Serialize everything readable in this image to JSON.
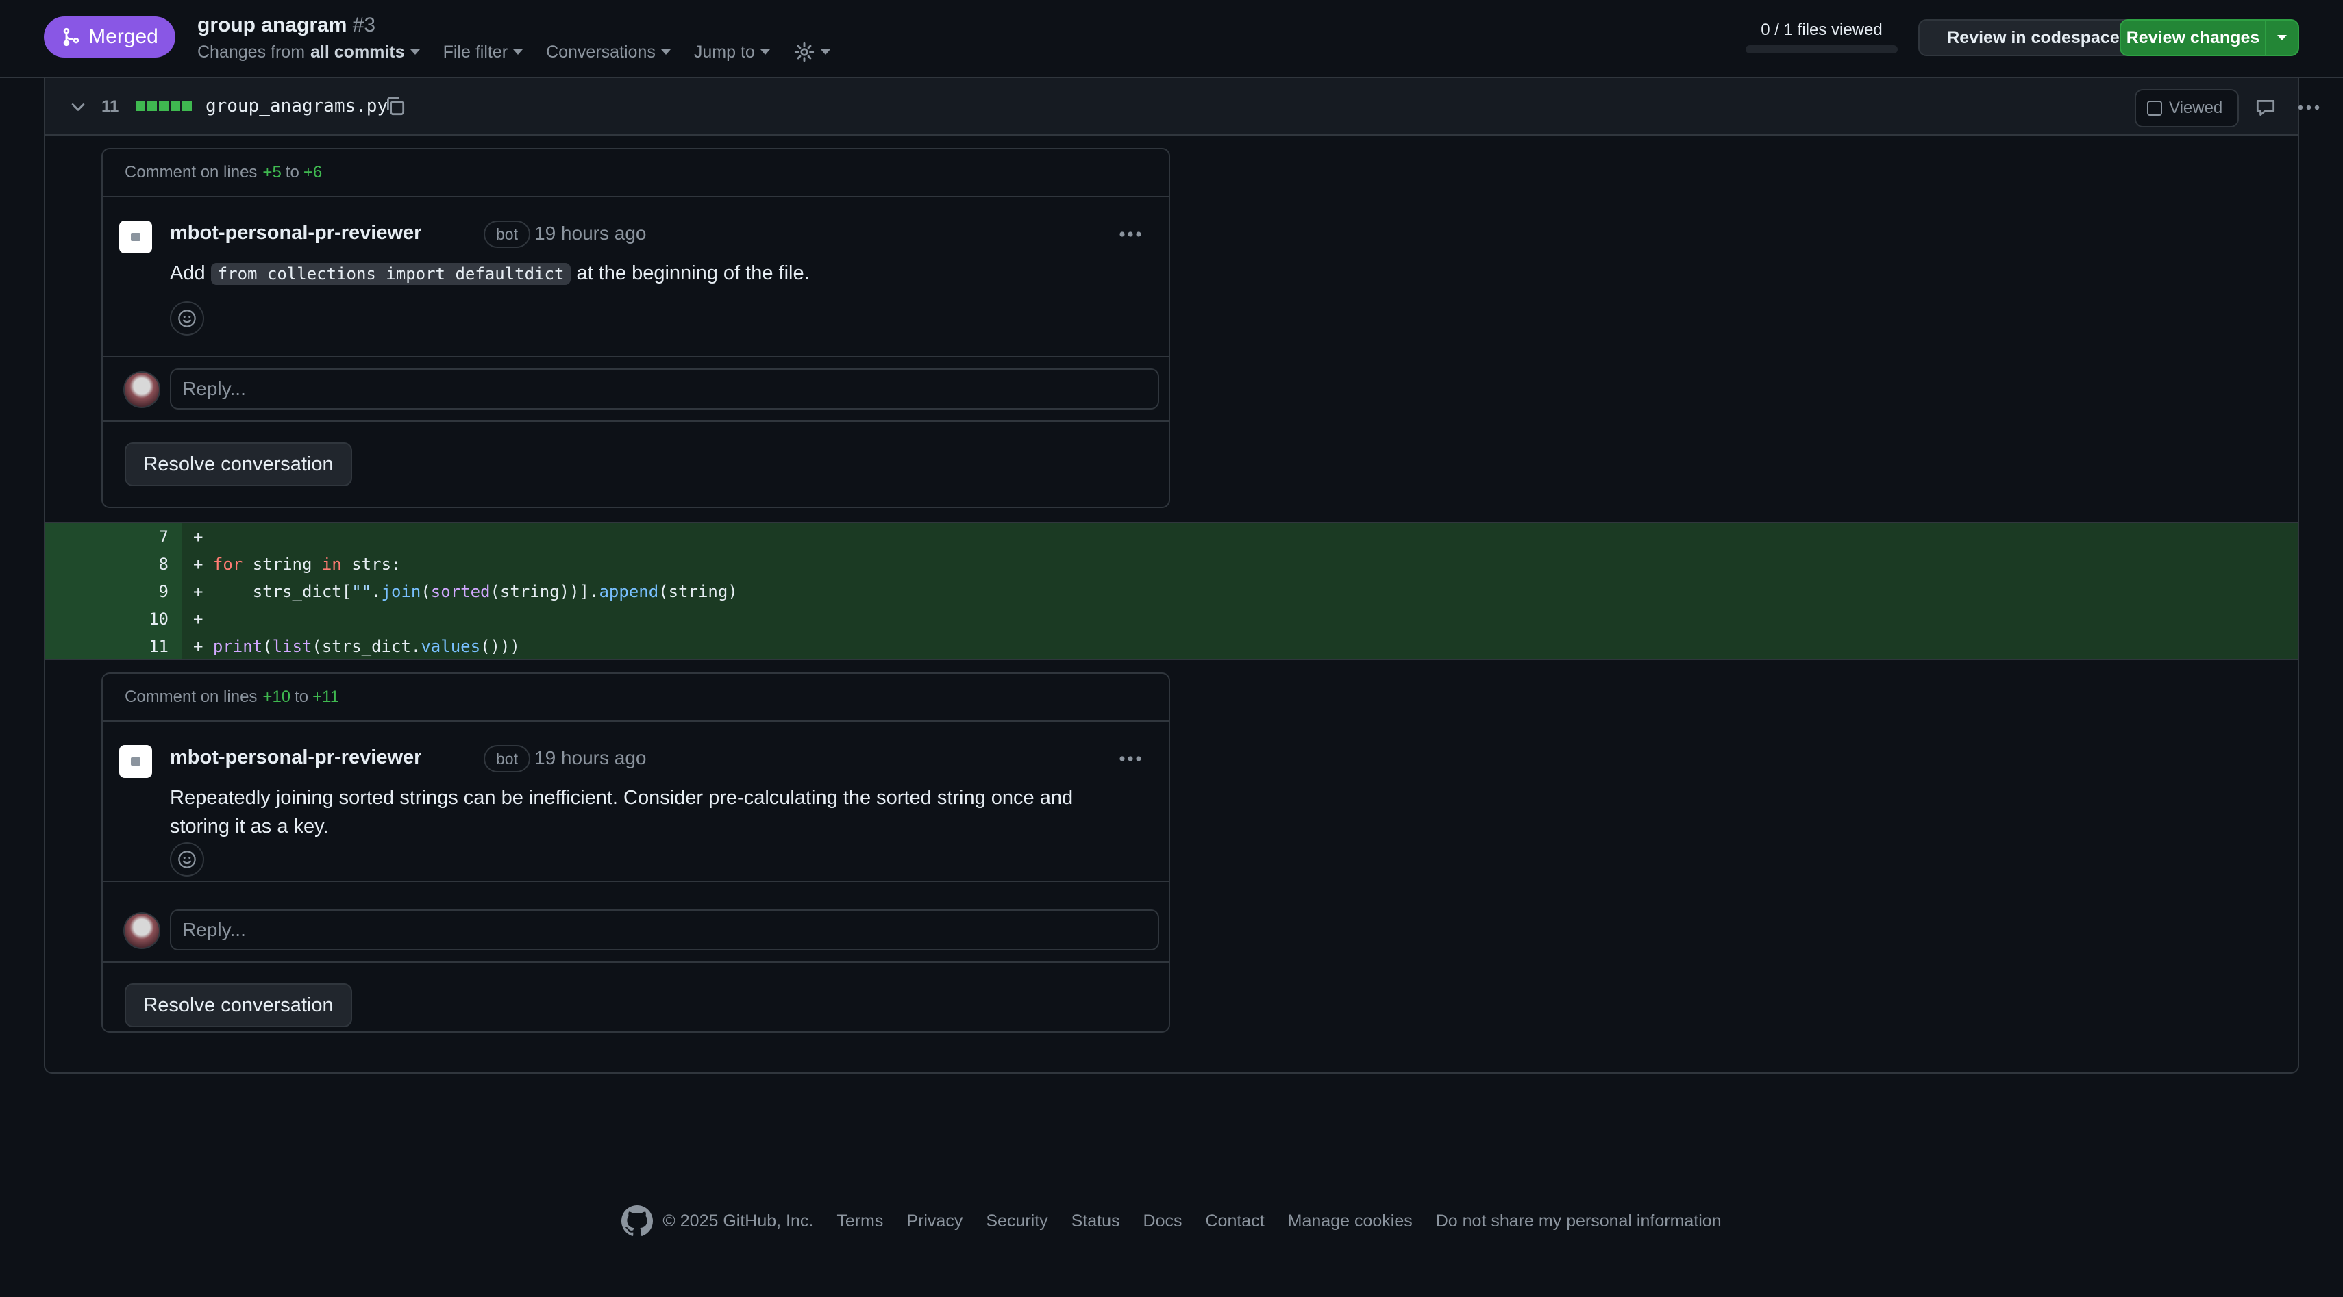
{
  "header": {
    "status_badge": "Merged",
    "pr_title": "group anagram",
    "pr_number": "#3",
    "changes_from_prefix": "Changes from",
    "changes_from_value": "all commits",
    "file_filter": "File filter",
    "conversations": "Conversations",
    "jump_to": "Jump to",
    "files_viewed": "0 / 1 files viewed",
    "files_viewed_progress": 0,
    "review_in_codespace": "Review in codespace",
    "review_changes": "Review changes"
  },
  "file": {
    "change_count": "11",
    "filename": "group_anagrams.py",
    "viewed_label": "Viewed"
  },
  "threads": [
    {
      "head_prefix": "Comment on lines",
      "line_start": "+5",
      "head_to": "to",
      "line_end": "+6",
      "author": "mbot-personal-pr-reviewer",
      "badge": "bot",
      "time": "19 hours ago",
      "body_before": "Add",
      "body_code": "from collections import defaultdict",
      "body_after": "at the beginning of the file.",
      "reply_placeholder": "Reply...",
      "resolve_label": "Resolve conversation"
    },
    {
      "head_prefix": "Comment on lines",
      "line_start": "+10",
      "head_to": "to",
      "line_end": "+11",
      "author": "mbot-personal-pr-reviewer",
      "badge": "bot",
      "time": "19 hours ago",
      "body": "Repeatedly joining sorted strings can be inefficient. Consider pre-calculating the sorted string once and storing it as a key.",
      "reply_placeholder": "Reply...",
      "resolve_label": "Resolve conversation"
    }
  ],
  "diff_lines": [
    {
      "num": "7",
      "code": "+"
    },
    {
      "num": "8",
      "code": "+ for string in strs:"
    },
    {
      "num": "9",
      "code": "+     strs_dict[\"\".join(sorted(string))].append(string)"
    },
    {
      "num": "10",
      "code": "+"
    },
    {
      "num": "11",
      "code": "+ print(list(strs_dict.values()))"
    }
  ],
  "footer": {
    "copyright": "© 2025 GitHub, Inc.",
    "links": [
      "Terms",
      "Privacy",
      "Security",
      "Status",
      "Docs",
      "Contact",
      "Manage cookies",
      "Do not share my personal information"
    ]
  },
  "colors": {
    "merged": "#8957e5",
    "added": "#3fb950",
    "review_button": "#238636",
    "background": "#0d1117"
  }
}
